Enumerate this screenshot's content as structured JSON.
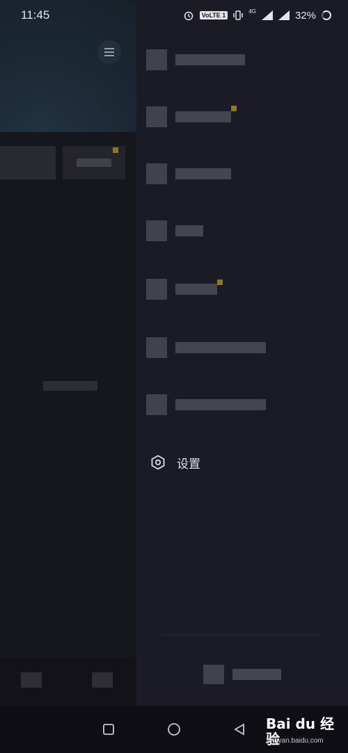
{
  "status_bar": {
    "time": "11:45",
    "volte_badge": "VoLTE 1",
    "network": "4G",
    "battery": "32%"
  },
  "drawer": {
    "settings_label": "设置"
  },
  "watermark": {
    "brand": "Bai du 经验",
    "url": "jingyan.baidu.com"
  },
  "colors": {
    "background": "#1a1a24",
    "drawer": "#1b1b25",
    "accent_dot": "#8a7a22"
  }
}
